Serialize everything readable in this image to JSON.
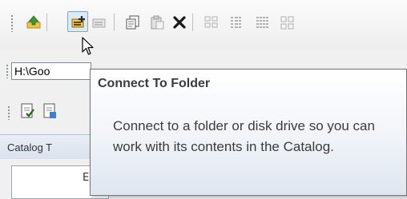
{
  "toolbar": {
    "buttons": [
      {
        "name": "up-one-level",
        "icon": "up-folder-icon"
      },
      {
        "name": "connect-to-folder",
        "icon": "connect-folder-icon",
        "state": "hover"
      },
      {
        "name": "disconnect-from-folder",
        "icon": "disconnect-folder-icon",
        "state": "disabled"
      },
      {
        "name": "copy",
        "icon": "copy-icon"
      },
      {
        "name": "paste",
        "icon": "paste-icon",
        "state": "disabled"
      },
      {
        "name": "delete",
        "icon": "delete-icon"
      },
      {
        "name": "large-icons",
        "icon": "large-icons-icon",
        "state": "disabled"
      },
      {
        "name": "list",
        "icon": "list-icon",
        "state": "disabled"
      },
      {
        "name": "details",
        "icon": "details-icon",
        "state": "disabled"
      },
      {
        "name": "thumbnails",
        "icon": "thumbnails-icon",
        "state": "disabled"
      }
    ]
  },
  "location": {
    "value": "H:\\Goo"
  },
  "catalog": {
    "title": "Catalog T",
    "tree_text": "E"
  },
  "tooltip": {
    "title": "Connect To Folder",
    "description": "Connect to a folder or disk drive so you can work with its contents in the Catalog."
  },
  "colors": {
    "hover_fill": "#dce9f7",
    "hover_border": "#7fa7d6",
    "folder_yellow": "#f2c14e",
    "arrow_green": "#3c9a2a"
  }
}
